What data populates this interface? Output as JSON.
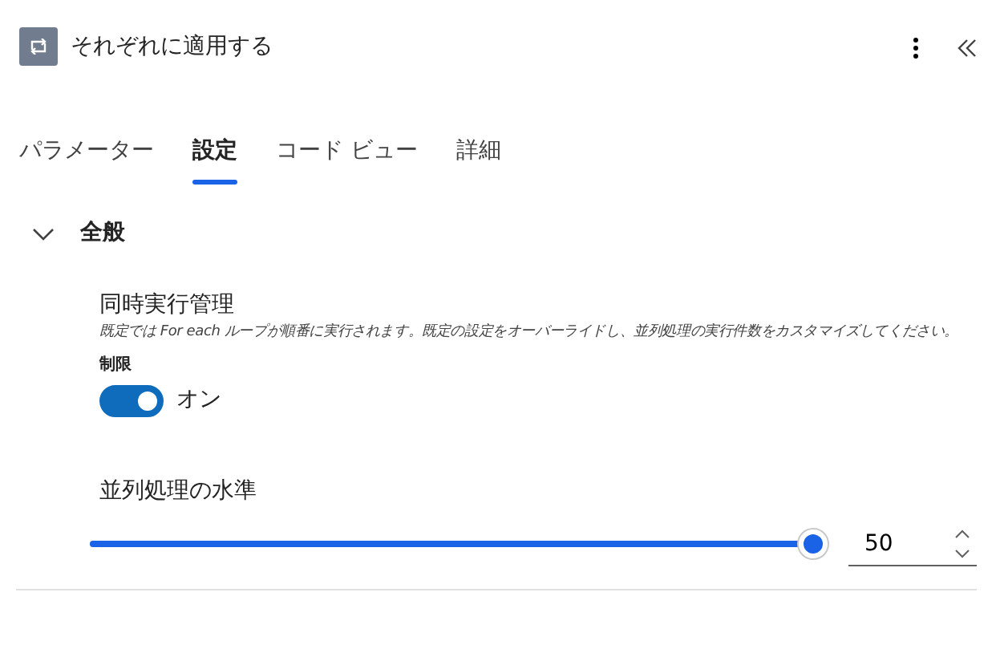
{
  "header": {
    "title": "それぞれに適用する"
  },
  "tabs": [
    {
      "label": "パラメーター",
      "selected": false
    },
    {
      "label": "設定",
      "selected": true
    },
    {
      "label": "コード ビュー",
      "selected": false
    },
    {
      "label": "詳細",
      "selected": false
    }
  ],
  "section": {
    "title": "全般",
    "expanded": true,
    "concurrency": {
      "title": "同時実行管理",
      "description": "既定では For each ループが順番に実行されます。既定の設定をオーバーライドし、並列処理の実行件数をカスタマイズしてください。",
      "toggle_label": "制限",
      "toggle": {
        "on": true,
        "text": "オン"
      }
    },
    "parallelism": {
      "title": "並列処理の水準",
      "level": 1.0,
      "value": "50"
    }
  }
}
